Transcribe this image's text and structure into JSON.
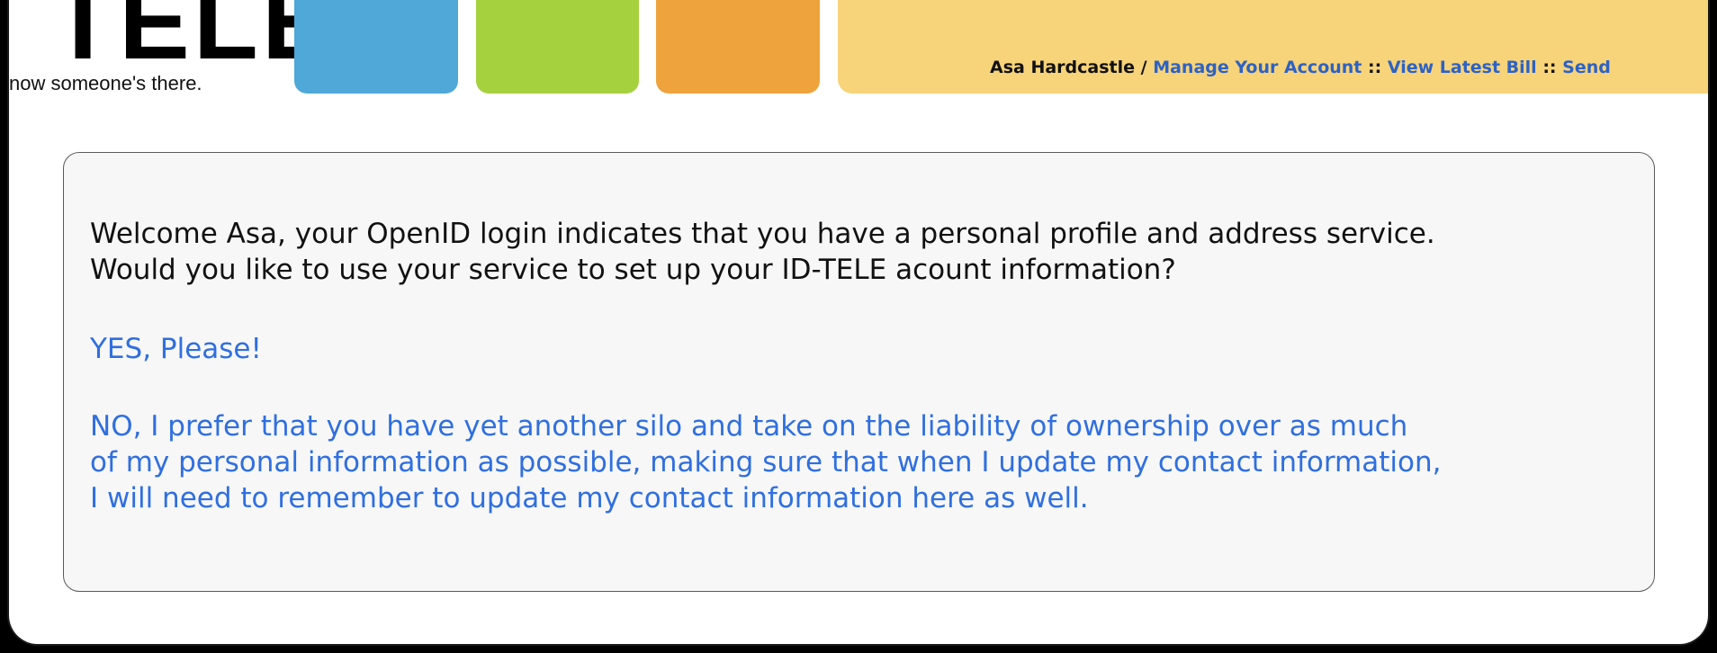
{
  "header": {
    "logo_text": "TELE",
    "tagline": "now someone's there.",
    "user_name": "Asa Hardcastle",
    "separator_slash": " / ",
    "separator_colons": " :: ",
    "links": [
      "Manage Your Account",
      "View Latest Bill",
      "Send"
    ],
    "colors": {
      "blue": "#4fa8d8",
      "green": "#a6d13f",
      "orange": "#efa33d",
      "account_bar": "#f7d37a",
      "link": "#2d62c4"
    }
  },
  "prompt": {
    "welcome_lines": [
      "Welcome Asa, your OpenID login indicates that you have a personal profile and address service.",
      "Would you like to use your service to set up your ID-TELE acount information?"
    ],
    "yes_label": "YES, Please!",
    "no_lines": [
      "NO, I prefer that you have yet another silo and take on the liability of ownership over as much",
      "of my personal information as possible, making sure that when I update my contact information,",
      "I will need to remember to update my contact information here as well."
    ]
  }
}
